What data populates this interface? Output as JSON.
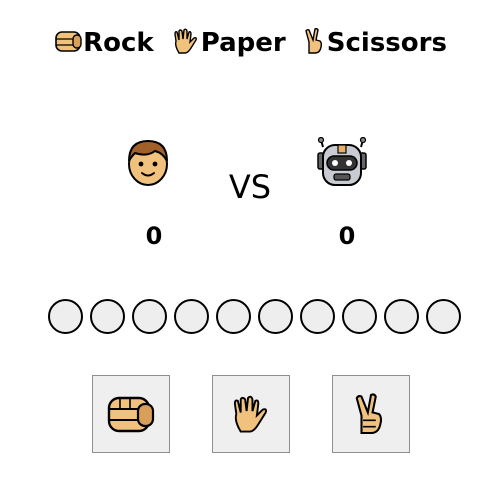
{
  "title": {
    "rock_label": "Rock",
    "paper_label": "Paper",
    "scissors_label": "Scissors"
  },
  "icons": {
    "rock": "fist-icon",
    "paper": "raised-hand-icon",
    "scissors": "victory-hand-icon",
    "player": "boy-face-icon",
    "cpu": "robot-face-icon"
  },
  "versus_label": "VS",
  "scores": {
    "player": "0",
    "cpu": "0"
  },
  "rounds": [
    {
      "state": "empty"
    },
    {
      "state": "empty"
    },
    {
      "state": "empty"
    },
    {
      "state": "empty"
    },
    {
      "state": "empty"
    },
    {
      "state": "empty"
    },
    {
      "state": "empty"
    },
    {
      "state": "empty"
    },
    {
      "state": "empty"
    },
    {
      "state": "empty"
    }
  ],
  "colors": {
    "skin": "#f1c27d",
    "skin_dark": "#d99e5a",
    "hair": "#a0602a",
    "robot_metal": "#c8ccd2",
    "round_fill": "#eeeeee",
    "button_bg": "#efefef"
  }
}
